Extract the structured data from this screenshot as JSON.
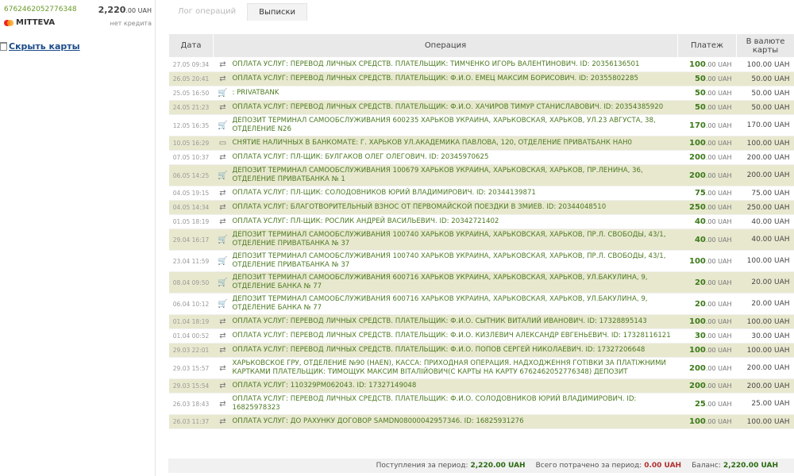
{
  "sidebar": {
    "card_number": "6762462052776348",
    "balance": "2,220",
    "balance_dec": ".00 UAH",
    "card_name": "MITTEVA",
    "credit_note": "нет кредита",
    "hide_cards": "Скрыть карты"
  },
  "tabs": [
    "Лог операций",
    "Выписки"
  ],
  "table": {
    "headers": [
      "Дата",
      "Операция",
      "Платеж",
      "В валюте карты"
    ],
    "rows": [
      {
        "date": "27.05 09:34",
        "icon": "transfer-icon",
        "op": "ОПЛАТА УСЛУГ: ПЕРЕВОД ЛИЧНЫХ СРЕДСТВ. ПЛАТЕЛЬЩИК: ТИМЧЕНКО ИГОРЬ ВАЛЕНТИНОВИЧ. ID: 20356136501",
        "pay": "100",
        "cur": "100.00 UAH"
      },
      {
        "date": "26.05 20:41",
        "icon": "transfer-icon",
        "op": "ОПЛАТА УСЛУГ: ПЕРЕВОД ЛИЧНЫХ СРЕДСТВ. ПЛАТЕЛЬЩИК: Ф.И.О. ЕМЕЦ МАКСИМ БОРИСОВИЧ. ID: 20355802285",
        "pay": "50",
        "cur": "50.00 UAH"
      },
      {
        "date": "25.05 16:50",
        "icon": "cart-icon",
        "op": ": PRIVATBANK",
        "pay": "50",
        "cur": "50.00 UAH"
      },
      {
        "date": "24.05 21:23",
        "icon": "transfer-icon",
        "op": "ОПЛАТА УСЛУГ: ПЕРЕВОД ЛИЧНЫХ СРЕДСТВ. ПЛАТЕЛЬЩИК: Ф.И.О. ХАЧИРОВ ТИМУР СТАНИСЛАВОВИЧ. ID: 20354385920",
        "pay": "50",
        "cur": "50.00 UAH"
      },
      {
        "date": "12.05 16:35",
        "icon": "cart-icon",
        "op": "ДЕПОЗИТ ТЕРМИНАЛ САМООБСЛУЖИВАНИЯ 600235 ХАРЬКОВ УКРАИНА, ХАРЬКОВСКАЯ, ХАРЬКОВ, УЛ.23 АВГУСТА, 38, ОТДЕЛЕНИЕ N26",
        "pay": "170",
        "cur": "170.00 UAH"
      },
      {
        "date": "10.05 16:29",
        "icon": "atm-icon",
        "op": "СНЯТИЕ НАЛИЧНЫХ В БАНКОМАТЕ: Г. ХАРЬКОВ УЛ.АКАДЕМИКА ПАВЛОВА, 120, ОТДЕЛЕНИЕ ПРИВАТБАНК НАН0",
        "pay": "100",
        "cur": "100.00 UAH"
      },
      {
        "date": "07.05 10:37",
        "icon": "transfer-icon",
        "op": "ОПЛАТА УСЛУГ: ПЛ-ЩИК: БУЛГАКОВ ОЛЕГ ОЛЕГОВИЧ. ID: 20345970625",
        "pay": "200",
        "cur": "200.00 UAH"
      },
      {
        "date": "06.05 14:25",
        "icon": "cart-icon",
        "op": "ДЕПОЗИТ ТЕРМИНАЛ САМООБСЛУЖИВАНИЯ 100679 ХАРЬКОВ УКРАИНА, ХАРЬКОВСКАЯ, ХАРЬКОВ, ПР.ЛЕНИНА, 36, ОТДЕЛЕНИЕ ПРИВАТБАНКА № 1",
        "pay": "200",
        "cur": "200.00 UAH"
      },
      {
        "date": "04.05 19:15",
        "icon": "transfer-icon",
        "op": "ОПЛАТА УСЛУГ: ПЛ-ЩИК: СОЛОДОВНИКОВ ЮРИЙ ВЛАДИМИРОВИЧ. ID: 20344139871",
        "pay": "75",
        "cur": "75.00 UAH"
      },
      {
        "date": "04.05 14:34",
        "icon": "transfer-icon",
        "op": "ОПЛАТА УСЛУГ: БЛАГОТВОРИТЕЛЬНЫЙ ВЗНОС ОТ ПЕРВОМАЙСКОЙ ПОЕЗДКИ В ЗМИЕВ. ID: 20344048510",
        "pay": "250",
        "cur": "250.00 UAH"
      },
      {
        "date": "01.05 18:19",
        "icon": "transfer-icon",
        "op": "ОПЛАТА УСЛУГ: ПЛ-ЩИК: РОСЛИК АНДРЕЙ ВАСИЛЬЕВИЧ. ID: 20342721402",
        "pay": "40",
        "cur": "40.00 UAH"
      },
      {
        "date": "29.04 16:17",
        "icon": "cart-icon",
        "op": "ДЕПОЗИТ ТЕРМИНАЛ САМООБСЛУЖИВАНИЯ 100740 ХАРЬКОВ УКРАИНА, ХАРЬКОВСКАЯ, ХАРЬКОВ, ПР.Л. СВОБОДЫ, 43/1, ОТДЕЛЕНИЕ ПРИВАТБАНКА № 37",
        "pay": "40",
        "cur": "40.00 UAH"
      },
      {
        "date": "23.04 11:59",
        "icon": "cart-icon",
        "op": "ДЕПОЗИТ ТЕРМИНАЛ САМООБСЛУЖИВАНИЯ 100740 ХАРЬКОВ УКРАИНА, ХАРЬКОВСКАЯ, ХАРЬКОВ, ПР.Л. СВОБОДЫ, 43/1, ОТДЕЛЕНИЕ ПРИВАТБАНКА № 37",
        "pay": "100",
        "cur": "100.00 UAH"
      },
      {
        "date": "08.04 09:50",
        "icon": "cart-icon",
        "op": "ДЕПОЗИТ ТЕРМИНАЛ САМООБСЛУЖИВАНИЯ 600716 ХАРЬКОВ УКРАИНА, ХАРЬКОВСКАЯ, ХАРЬКОВ, УЛ.БАКУЛИНА, 9, ОТДЕЛЕНИЕ БАНКА № 77",
        "pay": "20",
        "cur": "20.00 UAH"
      },
      {
        "date": "06.04 10:12",
        "icon": "cart-icon",
        "op": "ДЕПОЗИТ ТЕРМИНАЛ САМООБСЛУЖИВАНИЯ 600716 ХАРЬКОВ УКРАИНА, ХАРЬКОВСКАЯ, ХАРЬКОВ, УЛ.БАКУЛИНА, 9, ОТДЕЛЕНИЕ БАНКА № 77",
        "pay": "20",
        "cur": "20.00 UAH"
      },
      {
        "date": "01.04 18:19",
        "icon": "transfer-icon",
        "op": "ОПЛАТА УСЛУГ: ПЕРЕВОД ЛИЧНЫХ СРЕДСТВ. ПЛАТЕЛЬЩИК: Ф.И.О. СЫТНИК ВИТАЛИЙ ИВАНОВИЧ. ID: 17328895143",
        "pay": "100",
        "cur": "100.00 UAH"
      },
      {
        "date": "01.04 00:52",
        "icon": "transfer-icon",
        "op": "ОПЛАТА УСЛУГ: ПЕРЕВОД ЛИЧНЫХ СРЕДСТВ. ПЛАТЕЛЬЩИК: Ф.И.О. КИЗЛЕВИЧ АЛЕКСАНДР ЕВГЕНЬЕВИЧ. ID: 17328116121",
        "pay": "30",
        "cur": "30.00 UAH"
      },
      {
        "date": "29.03 22:01",
        "icon": "transfer-icon",
        "op": "ОПЛАТА УСЛУГ: ПЕРЕВОД ЛИЧНЫХ СРЕДСТВ. ПЛАТЕЛЬЩИК: Ф.И.О. ПОПОВ СЕРГЕЙ НИКОЛАЕВИЧ. ID: 17327206648",
        "pay": "100",
        "cur": "100.00 UAH"
      },
      {
        "date": "29.03 15:57",
        "icon": "transfer-icon",
        "op": "ХАРЬКОВСКОЕ ГРУ, ОТДЕЛЕНИЕ №90 (НАЕN), КАССА: ПРИХОДНАЯ ОПЕРАЦИЯ. НАДХОДЖЕННЯ ГОТІВКИ ЗА ПЛАТІЖНИМИ КАРТКАМИ ПЛАТЕЛЬЩИК: ТИМОЩУК МАКСИМ ВІТАЛІЙОВИЧ(С КАРТЫ НА КАРТУ 6762462052776348) ДЕПОЗИТ",
        "pay": "200",
        "cur": "200.00 UAH"
      },
      {
        "date": "29.03 15:54",
        "icon": "transfer-icon",
        "op": "ОПЛАТА УСЛУГ: 110329PM062043. ID: 17327149048",
        "pay": "200",
        "cur": "200.00 UAH"
      },
      {
        "date": "26.03 18:43",
        "icon": "transfer-icon",
        "op": "ОПЛАТА УСЛУГ: ПЕРЕВОД ЛИЧНЫХ СРЕДСТВ. ПЛАТЕЛЬЩИК: Ф.И.О. СОЛОДОВНИКОВ ЮРИЙ ВЛАДИМИРОВИЧ. ID: 16825978323",
        "pay": "25",
        "cur": "25.00 UAH"
      },
      {
        "date": "26.03 11:37",
        "icon": "transfer-icon",
        "op": "ОПЛАТА УСЛУГ: ДО РАХУНКУ ДОГОВОР SAMDN08000042957346. ID: 16825931276",
        "pay": "100",
        "cur": "100.00 UAH"
      }
    ],
    "pay_suffix": ".00 UAH"
  },
  "footer": {
    "income_label": "Поступления за период:",
    "income_value": "2,220.00 UAH",
    "spent_label": "Всего потрачено за период:",
    "spent_value": "0.00 UAH",
    "balance_label": "Баланс:",
    "balance_value": "2,220.00 UAH"
  }
}
